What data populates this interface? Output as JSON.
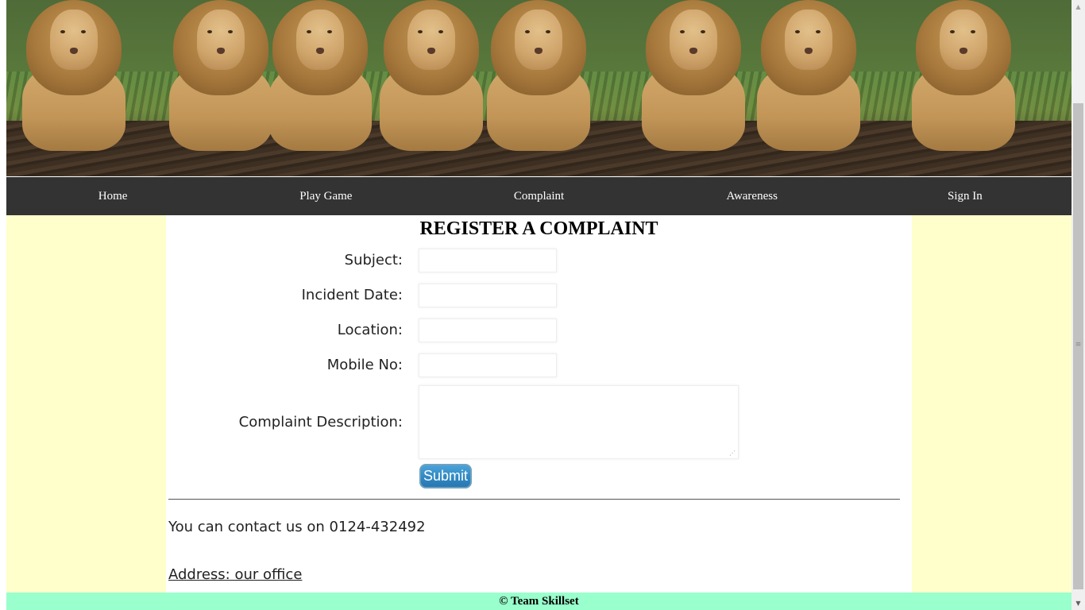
{
  "banner": {
    "image": "lions-banner-photo"
  },
  "nav": {
    "items": [
      {
        "label": "Home"
      },
      {
        "label": "Play Game"
      },
      {
        "label": "Complaint"
      },
      {
        "label": "Awareness"
      },
      {
        "label": "Sign In"
      }
    ]
  },
  "form": {
    "title": "REGISTER A COMPLAINT",
    "subject_label": "Subject:",
    "subject_value": "",
    "date_label": "Incident Date:",
    "date_value": "",
    "location_label": "Location:",
    "location_value": "",
    "mobile_label": "Mobile No:",
    "mobile_value": "",
    "description_label": "Complaint Description:",
    "description_value": "",
    "submit_label": "Submit"
  },
  "contact": {
    "text": "You can contact us on 0124-432492",
    "address_link": "Address: our office"
  },
  "footer": {
    "text": "© Team Skillset"
  },
  "colors": {
    "nav_bg": "#333333",
    "side_bg": "#ffffcc",
    "footer_bg": "#99ffcc",
    "button_bg": "#2e86c1"
  }
}
